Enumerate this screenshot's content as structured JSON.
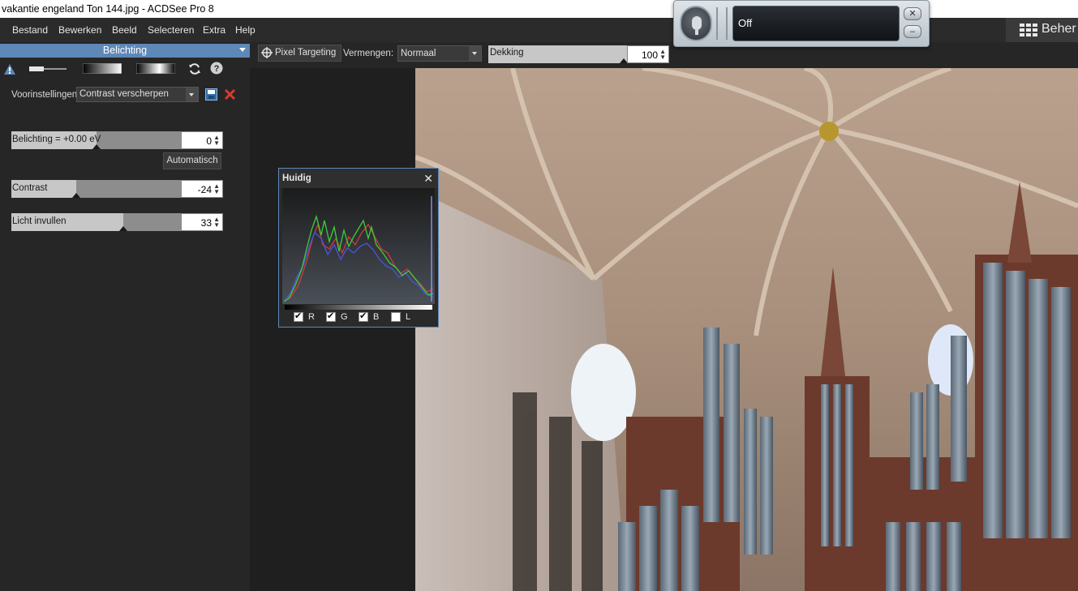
{
  "window": {
    "title": "vakantie engeland Ton 144.jpg - ACDSee Pro 8"
  },
  "menu": [
    {
      "label": "Bestand"
    },
    {
      "label": "Bewerken"
    },
    {
      "label": "Beeld"
    },
    {
      "label": "Selecteren"
    },
    {
      "label": "Extra"
    },
    {
      "label": "Help"
    }
  ],
  "voice": {
    "status": "Off",
    "close_icon": "close-icon",
    "minimize_icon": "minimize-icon"
  },
  "beheren": {
    "label": "Beher",
    "icon": "grid-icon"
  },
  "panel": {
    "header": "Belichting",
    "presets_label": "Voorinstellingen",
    "presets_value": "Contrast verscherpen",
    "exposure": {
      "label": "Belichting = +0.00 eV",
      "value": "0",
      "fraction": 0.5
    },
    "auto_button": "Automatisch",
    "contrast": {
      "label": "Contrast",
      "value": "-24",
      "fraction": 0.38
    },
    "fill_light": {
      "label": "Licht invullen",
      "value": "33",
      "fraction": 0.66
    }
  },
  "edit_toolbar": {
    "pixel_targeting": "Pixel Targeting",
    "blend_label": "Vermengen:",
    "blend_value": "Normaal",
    "opacity_label": "Dekking",
    "opacity_value": "100"
  },
  "histogram": {
    "title": "Huidig",
    "channels": [
      {
        "label": "R",
        "checked": true
      },
      {
        "label": "G",
        "checked": true
      },
      {
        "label": "B",
        "checked": true
      },
      {
        "label": "L",
        "checked": false
      }
    ]
  },
  "colors": {
    "accent": "#5d88b8",
    "panel_bg": "#262626",
    "delete_red": "#d93a2f"
  }
}
